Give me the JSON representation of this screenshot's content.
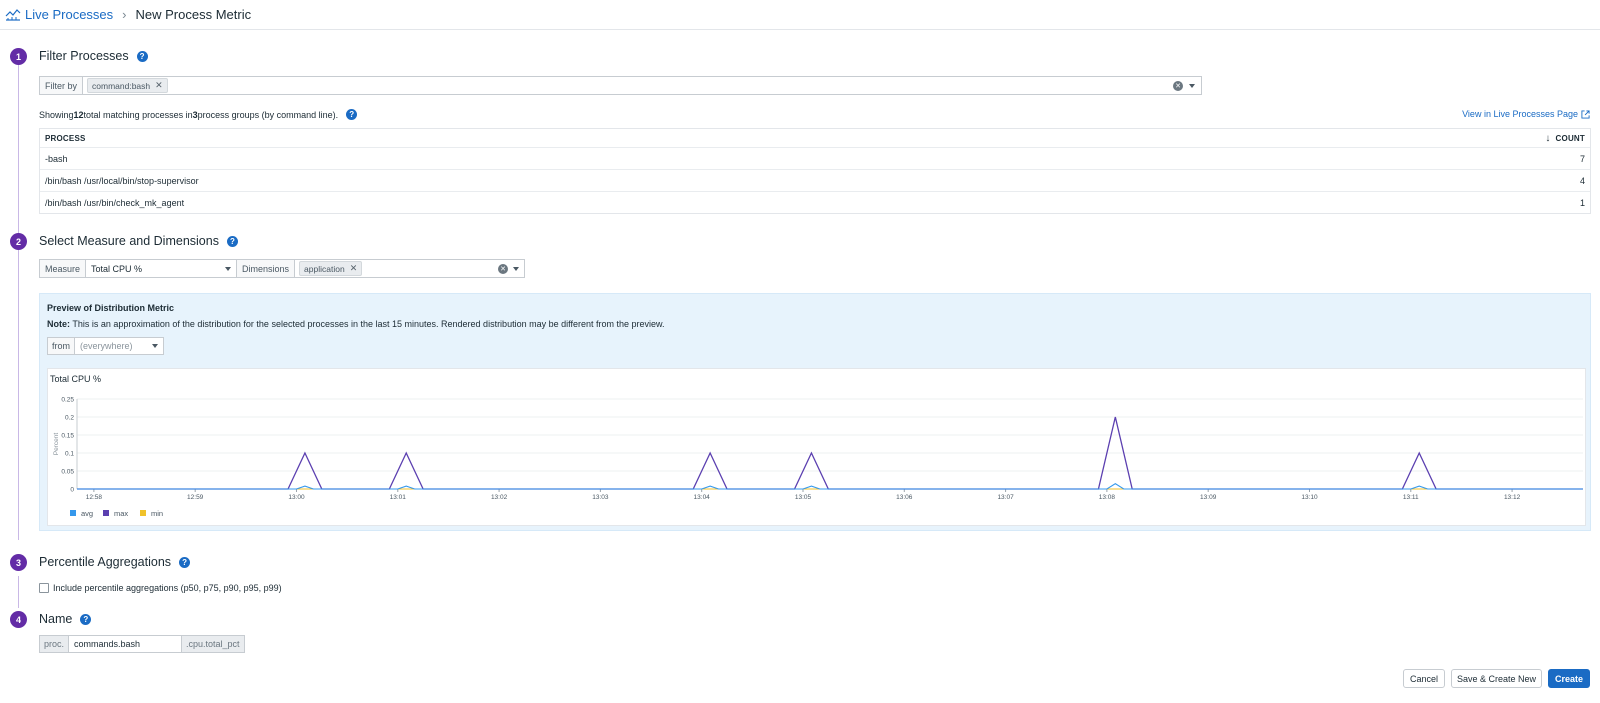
{
  "breadcrumb": {
    "parent": "Live Processes",
    "current": "New Process Metric"
  },
  "steps": {
    "one": {
      "number": "1",
      "title": "Filter Processes"
    },
    "two": {
      "number": "2",
      "title": "Select Measure and Dimensions"
    },
    "three": {
      "number": "3",
      "title": "Percentile Aggregations"
    },
    "four": {
      "number": "4",
      "title": "Name"
    }
  },
  "filter": {
    "prefix": "Filter by",
    "chip": "command:bash"
  },
  "summary": {
    "pre": "Showing ",
    "total": "12",
    "mid": " total matching processes in ",
    "groups": "3",
    "post": " process groups (by command line)."
  },
  "view_link": "View in Live Processes Page",
  "table": {
    "headers": {
      "process": "PROCESS",
      "count": "COUNT"
    },
    "rows": [
      {
        "process": "-bash",
        "count": "7"
      },
      {
        "process": "/bin/bash /usr/local/bin/stop-supervisor",
        "count": "4"
      },
      {
        "process": "/bin/bash /usr/bin/check_mk_agent",
        "count": "1"
      }
    ]
  },
  "measure": {
    "label": "Measure",
    "value": "Total CPU %",
    "dimensions_label": "Dimensions",
    "dimension_chip": "application"
  },
  "preview": {
    "title": "Preview of Distribution Metric",
    "note_label": "Note:",
    "note_text": " This is an approximation of the distribution for the selected processes in the last 15 minutes. Rendered distribution may be different from the preview.",
    "from_label": "from",
    "from_value": "(everywhere)"
  },
  "chart_data": {
    "type": "line",
    "title": "Total CPU %",
    "ylabel": "Percent",
    "ylim": [
      0,
      0.25
    ],
    "yticks": [
      0,
      0.05,
      0.1,
      0.15,
      0.2,
      0.25
    ],
    "ytick_labels": [
      "0",
      "0.05",
      "0.1",
      "0.15",
      "0.2",
      "0.25"
    ],
    "xlim": [
      "12:57:50",
      "13:12:42"
    ],
    "xticks": [
      "12:58",
      "12:59",
      "13:00",
      "13:01",
      "13:02",
      "13:03",
      "13:04",
      "13:05",
      "13:06",
      "13:07",
      "13:08",
      "13:09",
      "13:10",
      "13:11",
      "13:12"
    ],
    "legend_position": "bottom-left",
    "series": [
      {
        "name": "avg",
        "color": "#3598ec",
        "points": [
          [
            "12:57:50",
            0
          ],
          [
            "13:00:00",
            0
          ],
          [
            "13:00:05",
            0.008
          ],
          [
            "13:00:10",
            0
          ],
          [
            "13:01:00",
            0
          ],
          [
            "13:01:05",
            0.008
          ],
          [
            "13:01:10",
            0
          ],
          [
            "13:04:00",
            0
          ],
          [
            "13:04:05",
            0.008
          ],
          [
            "13:04:10",
            0
          ],
          [
            "13:05:00",
            0
          ],
          [
            "13:05:05",
            0.008
          ],
          [
            "13:05:10",
            0
          ],
          [
            "13:08:00",
            0
          ],
          [
            "13:08:05",
            0.015
          ],
          [
            "13:08:10",
            0
          ],
          [
            "13:11:00",
            0
          ],
          [
            "13:11:05",
            0.008
          ],
          [
            "13:11:10",
            0
          ],
          [
            "13:12:42",
            0
          ]
        ]
      },
      {
        "name": "max",
        "color": "#5b3fb0",
        "points": [
          [
            "12:57:50",
            0
          ],
          [
            "12:59:55",
            0
          ],
          [
            "13:00:05",
            0.1
          ],
          [
            "13:00:15",
            0
          ],
          [
            "13:00:55",
            0
          ],
          [
            "13:01:05",
            0.1
          ],
          [
            "13:01:15",
            0
          ],
          [
            "13:03:55",
            0
          ],
          [
            "13:04:05",
            0.1
          ],
          [
            "13:04:15",
            0
          ],
          [
            "13:04:55",
            0
          ],
          [
            "13:05:05",
            0.1
          ],
          [
            "13:05:15",
            0
          ],
          [
            "13:07:55",
            0
          ],
          [
            "13:08:05",
            0.2
          ],
          [
            "13:08:15",
            0
          ],
          [
            "13:10:55",
            0
          ],
          [
            "13:11:05",
            0.1
          ],
          [
            "13:11:15",
            0
          ],
          [
            "13:12:42",
            0
          ]
        ]
      },
      {
        "name": "min",
        "color": "#f0c22b",
        "points": [
          [
            "12:57:50",
            0
          ],
          [
            "13:12:42",
            0
          ]
        ]
      }
    ]
  },
  "percentile": {
    "checkbox_label": "Include percentile aggregations (p50, p75, p90, p95, p99)"
  },
  "name": {
    "prefix": "proc.",
    "value": "commands.bash",
    "suffix": ".cpu.total_pct"
  },
  "buttons": {
    "cancel": "Cancel",
    "save_new": "Save & Create New",
    "create": "Create"
  },
  "colors": {
    "accent": "#632ca6",
    "link": "#1a6bc4",
    "preview_bg": "#e7f3fc"
  }
}
